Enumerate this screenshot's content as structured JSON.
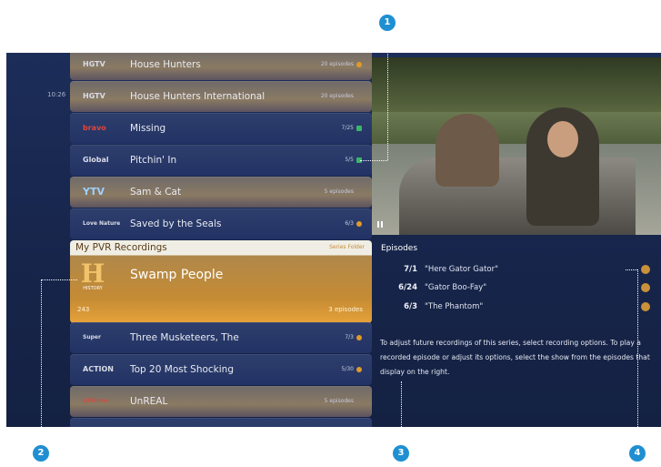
{
  "clock": "10:26",
  "recordings": [
    {
      "channel": "HGTV",
      "title": "House Hunters",
      "count": "20 episodes",
      "style": "gold",
      "status": "orange"
    },
    {
      "channel": "HGTV",
      "title": "House Hunters International",
      "count": "20 episodes",
      "style": "gold",
      "status": ""
    },
    {
      "channel": "bravo",
      "title": "Missing",
      "count": "7/25",
      "style": "blue",
      "status": "green"
    },
    {
      "channel": "Global",
      "title": "Pitchin' In",
      "count": "5/5",
      "style": "blue",
      "status": "green"
    },
    {
      "channel": "YTV",
      "title": "Sam & Cat",
      "count": "5 episodes",
      "style": "gold",
      "status": ""
    },
    {
      "channel": "Love Nature",
      "title": "Saved by the Seals",
      "count": "6/3",
      "style": "blue",
      "status": "orange"
    }
  ],
  "expanded": {
    "header": "My PVR Recordings",
    "tag": "Series Folder",
    "logo": "H",
    "logo_sub": "HISTORY",
    "title": "Swamp People",
    "channel": "243",
    "episodes": "3 episodes"
  },
  "recordings_after": [
    {
      "channel": "Super Movies",
      "title": "Three Musketeers, The",
      "count": "7/3",
      "style": "blue",
      "status": "orange"
    },
    {
      "channel": "ACTION",
      "title": "Top 20 Most Shocking",
      "count": "5/30",
      "style": "blue",
      "status": "orange"
    },
    {
      "channel": "Lifetime",
      "title": "UnREAL",
      "count": "5 episodes",
      "style": "gold",
      "status": ""
    }
  ],
  "episodes_panel": {
    "title": "Episodes",
    "items": [
      {
        "date": "7/1",
        "name": "\"Here Gator Gator\""
      },
      {
        "date": "6/24",
        "name": "\"Gator Boo-Fay\""
      },
      {
        "date": "6/3",
        "name": "\"The Phantom\""
      }
    ],
    "description": "To adjust future recordings of this series, select recording options. To play a recorded episode or adjust its options, select the show from the episodes that display on the right."
  },
  "callouts": [
    "1",
    "2",
    "3",
    "4"
  ],
  "colors": {
    "accent": "#1f8fd2",
    "gold": "#c58b34",
    "background": "#1c2d59"
  }
}
